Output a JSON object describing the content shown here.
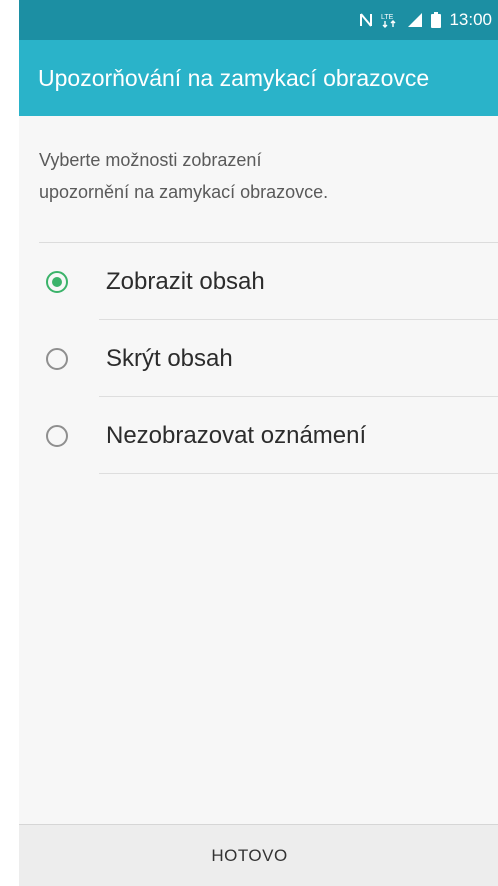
{
  "status_bar": {
    "time": "13:00",
    "icons": [
      "nfc-icon",
      "lte-icon",
      "signal-icon",
      "battery-icon"
    ],
    "network_label": "LTE"
  },
  "app_bar": {
    "title": "Upozorňování na zamykací obrazovce"
  },
  "description": {
    "line1": "Vyberte možnosti zobrazení",
    "line2": "upozornění na zamykací obrazovce."
  },
  "options": [
    {
      "label": "Zobrazit obsah",
      "selected": true
    },
    {
      "label": "Skrýt obsah",
      "selected": false
    },
    {
      "label": "Nezobrazovat oznámení",
      "selected": false
    }
  ],
  "footer": {
    "done_label": "HOTOVO"
  },
  "colors": {
    "status_bar": "#1c8fa3",
    "app_bar": "#2ab3c9",
    "radio_selected": "#3bb36a",
    "background": "#f7f7f7"
  }
}
